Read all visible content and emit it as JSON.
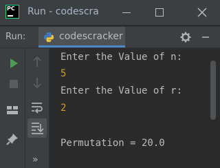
{
  "window": {
    "title": "Run - codescracker",
    "logo_text": "PC",
    "logo_color": "#21d789"
  },
  "run_panel": {
    "label": "Run:",
    "tab_label": "codescracker",
    "tab_icon": "python-icon",
    "accent": "#4a88c7"
  },
  "toolbar_icons": {
    "left": [
      "run-icon",
      "stop-icon",
      "layout-icon",
      "pin-icon"
    ],
    "middle": [
      "up-arrow-icon",
      "down-arrow-icon",
      "soft-wrap-icon",
      "scroll-to-end-icon",
      "more-icon"
    ]
  },
  "console": {
    "prompt_n": "Enter the Value of n:",
    "input_n": "5",
    "prompt_r": "Enter the Value of r:",
    "input_r": "2",
    "result": "Permutation = 20.0",
    "input_color": "#c8a030"
  },
  "more_glyph": "»"
}
